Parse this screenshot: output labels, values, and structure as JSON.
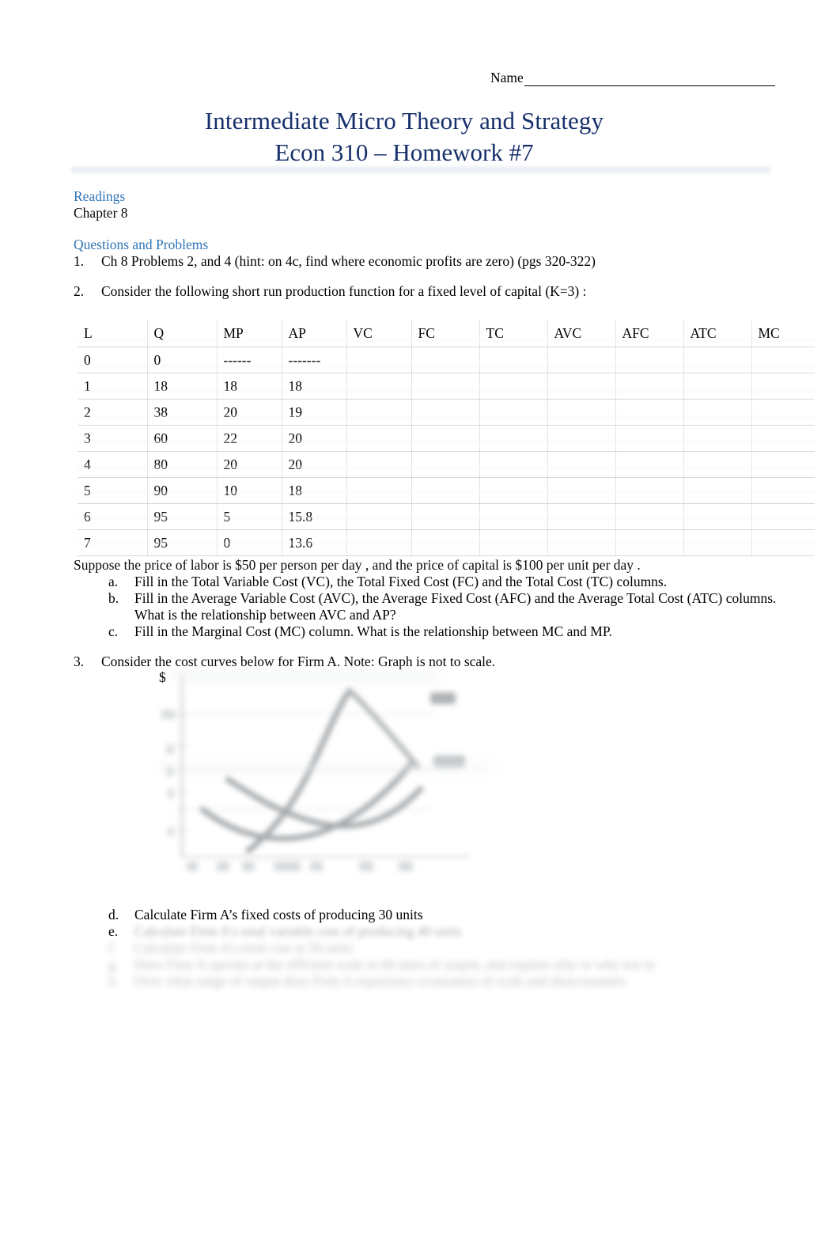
{
  "header": {
    "name_label": "Name",
    "name_value": ""
  },
  "title": {
    "line1": "Intermediate Micro Theory and Strategy",
    "line2": "Econ 310 – Homework #7",
    "color": "#17306c"
  },
  "sections": {
    "readings": {
      "heading": "Readings",
      "body": "Chapter 8",
      "heading_color": "#2f75b5"
    },
    "questions_heading": "Questions and Problems"
  },
  "questions": [
    {
      "marker": "1.",
      "text": "Ch 8 Problems 2, and 4 (hint: on 4c, find where economic profits are zero) (pgs 320-322)"
    },
    {
      "marker": "2.",
      "text": "Consider the following short run production function for a fixed level of capital (K=3)  :"
    },
    {
      "marker": "3.",
      "text": "Consider the cost curves below for Firm A.  Note:  Graph is not to scale."
    }
  ],
  "table": {
    "headers": [
      "L",
      "Q",
      "MP",
      "AP",
      "VC",
      "FC",
      "TC",
      "AVC",
      "AFC",
      "ATC",
      "MC"
    ],
    "rows": [
      [
        "0",
        "0",
        "------",
        "-------",
        "",
        "",
        "",
        "",
        "",
        "",
        ""
      ],
      [
        "1",
        "18",
        "18",
        "18",
        "",
        "",
        "",
        "",
        "",
        "",
        ""
      ],
      [
        "2",
        "38",
        "20",
        "19",
        "",
        "",
        "",
        "",
        "",
        "",
        ""
      ],
      [
        "3",
        "60",
        "22",
        "20",
        "",
        "",
        "",
        "",
        "",
        "",
        ""
      ],
      [
        "4",
        "80",
        "20",
        "20",
        "",
        "",
        "",
        "",
        "",
        "",
        ""
      ],
      [
        "5",
        "90",
        "10",
        "18",
        "",
        "",
        "",
        "",
        "",
        "",
        ""
      ],
      [
        "6",
        "95",
        "5",
        "15.8",
        "",
        "",
        "",
        "",
        "",
        "",
        ""
      ],
      [
        "7",
        "95",
        "0",
        "13.6",
        "",
        "",
        "",
        "",
        "",
        "",
        ""
      ]
    ]
  },
  "suppose_text": "Suppose the price of labor is $50 per person per day    , and the price of capital is $100 per unit per day   .",
  "subparts_abc": [
    {
      "marker": "a.",
      "line1": "Fill in the Total Variable Cost (VC), the Total Fixed Cost (FC) and the Total Cost (TC) columns.",
      "line2": ""
    },
    {
      "marker": "b.",
      "line1": "Fill in the Average Variable Cost (AVC), the Average Fixed Cost (AFC) and the Average Total Cost (ATC) columns.",
      "line2": "What is the relationship between AVC and AP?"
    },
    {
      "marker": "c.",
      "line1": "Fill in the Marginal Cost (MC) column.  What is the relationship between MC and MP.",
      "line2": ""
    }
  ],
  "graph": {
    "y_axis_label": "$",
    "curve_labels": [
      "MC",
      "ATC"
    ],
    "note": "cost curves, not to scale"
  },
  "subparts_def": [
    {
      "marker": "d.",
      "text": "Calculate Firm A’s fixed costs of producing 30 units",
      "redacted": false
    },
    {
      "marker": "e.",
      "text": "Calculate Firm A's total variable cost of producing 40 units",
      "redacted": true
    },
    {
      "marker": "f.",
      "text": "Calculate Firm A's total cost at 50 units",
      "redacted": true
    },
    {
      "marker": "g.",
      "text": "Does Firm A operate at the efficient scale at 60 units of output, and explain why or why not in",
      "redacted": true
    },
    {
      "marker": "h.",
      "text": "Over what range of output does Firm A experience economies of scale and diseconomies",
      "redacted": true
    }
  ]
}
